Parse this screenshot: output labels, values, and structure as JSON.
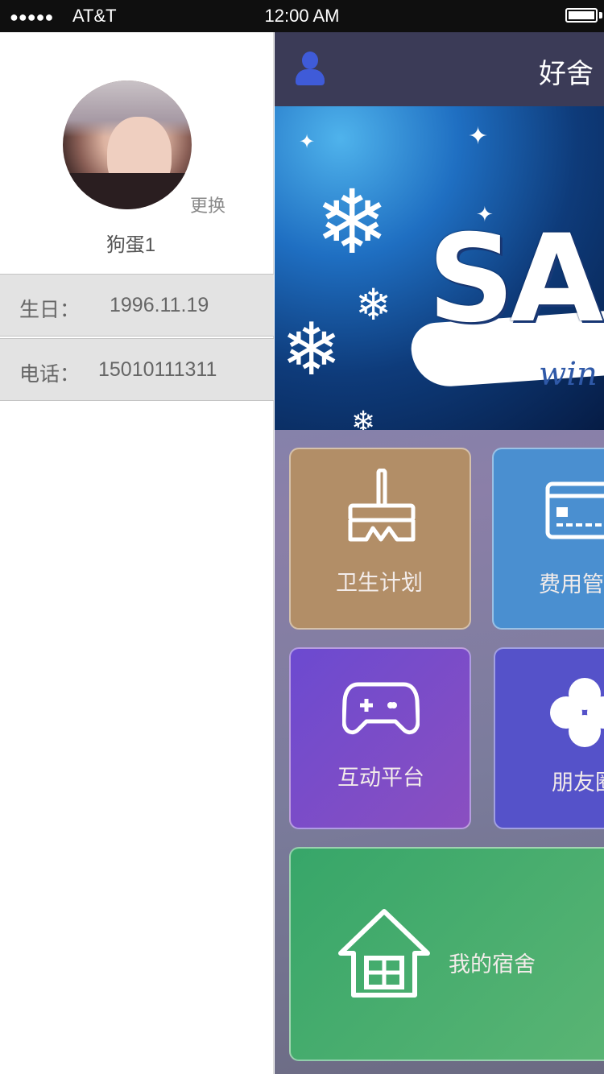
{
  "status_bar": {
    "signal": "●●●●●",
    "carrier": "AT&T",
    "time": "12:00 AM"
  },
  "drawer": {
    "change_avatar_label": "更换",
    "username": "狗蛋1",
    "birthday": {
      "label": "生日：",
      "value": "1996.11.19"
    },
    "phone": {
      "label": "电话：",
      "value": "15010111311"
    }
  },
  "main": {
    "title": "好舍",
    "banner": {
      "headline": "SA",
      "ribbon_text": "win"
    },
    "tiles": [
      {
        "label": "卫生计划",
        "icon": "broom-icon",
        "color": "#b28e67"
      },
      {
        "label": "费用管",
        "icon": "card-icon",
        "color": "#4a8fd0"
      },
      {
        "label": "互动平台",
        "icon": "gamepad-icon",
        "color": "#7b4fc4"
      },
      {
        "label": "朋友圈",
        "icon": "clover-icon",
        "color": "#5552c9"
      },
      {
        "label": "我的宿舍",
        "icon": "house-icon",
        "color": "#47a96a"
      }
    ]
  },
  "colors": {
    "status_bar": "#0f0f0f",
    "navbar": "#3b3b57",
    "user_icon": "#3f5bd8"
  }
}
